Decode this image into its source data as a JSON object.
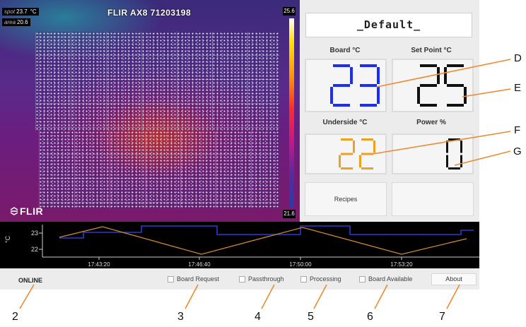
{
  "camera": {
    "title": "FLIR AX8 71203198",
    "spot_label": "spot",
    "spot_value": "23.7",
    "spot_unit": "°C",
    "area_label": "area",
    "area_value": "20.6",
    "scale_max": "25.6",
    "scale_min": "21.6",
    "logo": "FLIR"
  },
  "panel": {
    "recipe_name": "_Default_",
    "board_label": "Board °C",
    "setpoint_label": "Set Point  °C",
    "underside_label": "Underside °C",
    "power_label": "Power %",
    "board_value": "23",
    "setpoint_value": "25",
    "underside_value": "22",
    "power_value": "0",
    "recipes_button": "Recipes",
    "colors": {
      "board_digits": "#1a2cff",
      "setpoint_digits": "#111111",
      "underside_digits": "#f0a020",
      "power_digits": "#111111"
    }
  },
  "trend": {
    "y_unit_label": "°C",
    "y_ticks": [
      "23",
      "22"
    ],
    "x_ticks": [
      "17:43:20",
      "17:46:40",
      "17:50:00",
      "17:53:20"
    ],
    "series_colors": {
      "setpoint": "#2a3ad0",
      "measured": "#d08a20"
    }
  },
  "status": {
    "connection": "ONLINE",
    "board_request": "Board Request",
    "passthrough": "Passthrough",
    "processing": "Processing",
    "board_available": "Board Available",
    "about_button": "About"
  },
  "callouts": {
    "letters": [
      "D",
      "E",
      "F",
      "G"
    ],
    "numbers": [
      "2",
      "3",
      "4",
      "5",
      "6",
      "7"
    ]
  }
}
